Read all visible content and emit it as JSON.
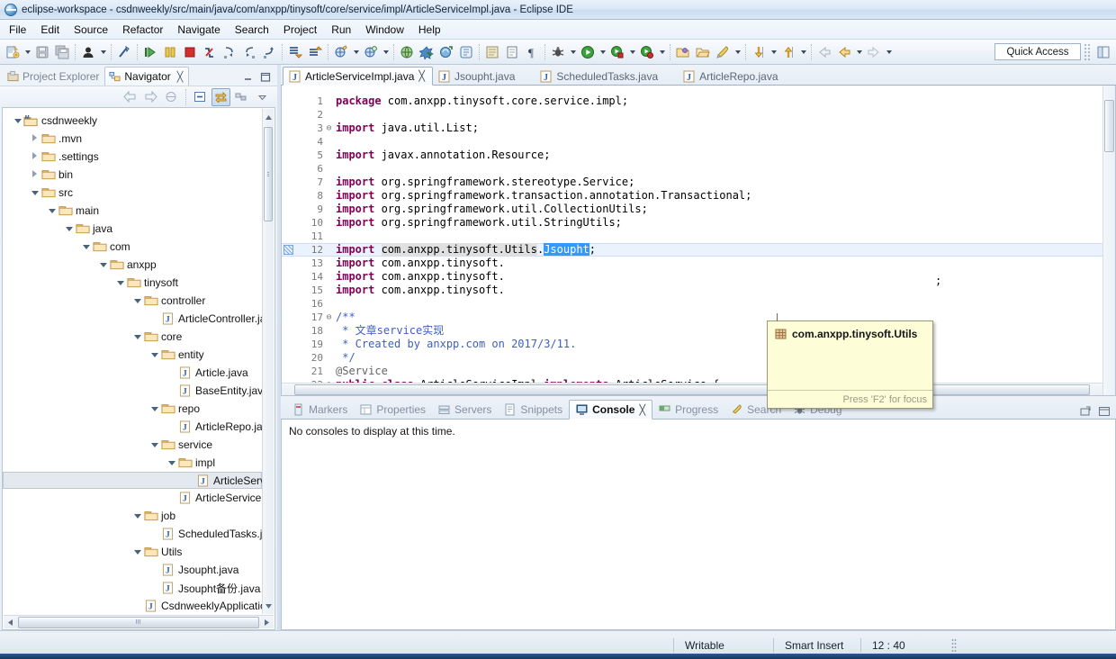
{
  "window": {
    "title": "eclipse-workspace - csdnweekly/src/main/java/com/anxpp/tinysoft/core/service/impl/ArticleServiceImpl.java - Eclipse IDE"
  },
  "menubar": {
    "items": [
      "File",
      "Edit",
      "Source",
      "Refactor",
      "Navigate",
      "Search",
      "Project",
      "Run",
      "Window",
      "Help"
    ]
  },
  "toolbar": {
    "quick_access": "Quick Access",
    "icons": [
      "new-wizard-icon",
      "new-dropdown-icon",
      "save-icon",
      "save-all-icon",
      "person-icon",
      "person-dropdown-icon",
      "toggle-breakpoint-icon",
      "resume-icon",
      "suspend-icon",
      "terminate-icon",
      "disconnect-icon",
      "step-into-icon",
      "step-over-icon",
      "step-return-icon",
      "next-annotation-icon",
      "previous-annotation-icon",
      "open-type-icon",
      "open-type-dropdown-icon",
      "search-icon",
      "search-dropdown-icon",
      "web-browser-icon",
      "debug-perspective-icon",
      "new-java-project-icon",
      "java-editor-icon",
      "new-class-icon",
      "new-package-icon",
      "toggle-mark-occurrences-icon",
      "show-whitespace-icon",
      "pilcrow-icon",
      "debug-launch-icon",
      "debug-dropdown-icon",
      "run-launch-icon",
      "run-dropdown-icon",
      "run-coverage-icon",
      "coverage-dropdown-icon",
      "external-tools-icon",
      "external-tools-dropdown-icon",
      "open-folder-icon",
      "open-file-icon",
      "run-ant-icon",
      "run-ant-dropdown-icon",
      "previous-edit-icon",
      "previous-dropdown-icon",
      "next-edit-icon",
      "next-dropdown-icon",
      "back-icon",
      "forward-icon",
      "forward-dropdown-icon",
      "next-page-icon",
      "next-page-dropdown-icon"
    ]
  },
  "left_view": {
    "tabs": [
      {
        "label": "Project Explorer",
        "active": false,
        "icon": "project-explorer-icon"
      },
      {
        "label": "Navigator",
        "active": true,
        "icon": "navigator-icon",
        "close": "╳"
      }
    ],
    "controls": [
      "minimize-icon",
      "maximize-icon"
    ],
    "view_toolbar": [
      "back-icon",
      "forward-icon",
      "home-icon",
      "collapse-all-icon",
      "link-with-editor-icon",
      "view-menu-icon",
      "view-dropdown-icon"
    ],
    "tree": [
      {
        "label": "csdnweekly",
        "depth": 0,
        "state": "expanded",
        "icon": "project-icon"
      },
      {
        "label": ".mvn",
        "depth": 1,
        "state": "collapsed",
        "icon": "folder-icon"
      },
      {
        "label": ".settings",
        "depth": 1,
        "state": "collapsed",
        "icon": "folder-icon"
      },
      {
        "label": "bin",
        "depth": 1,
        "state": "collapsed",
        "icon": "folder-icon"
      },
      {
        "label": "src",
        "depth": 1,
        "state": "expanded",
        "icon": "folder-icon"
      },
      {
        "label": "main",
        "depth": 2,
        "state": "expanded",
        "icon": "folder-icon"
      },
      {
        "label": "java",
        "depth": 3,
        "state": "expanded",
        "icon": "folder-icon"
      },
      {
        "label": "com",
        "depth": 4,
        "state": "expanded",
        "icon": "folder-icon"
      },
      {
        "label": "anxpp",
        "depth": 5,
        "state": "expanded",
        "icon": "folder-icon"
      },
      {
        "label": "tinysoft",
        "depth": 6,
        "state": "expanded",
        "icon": "folder-icon"
      },
      {
        "label": "controller",
        "depth": 7,
        "state": "expanded",
        "icon": "folder-icon"
      },
      {
        "label": "ArticleController.java",
        "depth": 8,
        "state": "leaf",
        "icon": "java-file-icon"
      },
      {
        "label": "core",
        "depth": 7,
        "state": "expanded",
        "icon": "folder-icon"
      },
      {
        "label": "entity",
        "depth": 8,
        "state": "expanded",
        "icon": "folder-icon"
      },
      {
        "label": "Article.java",
        "depth": 9,
        "state": "leaf",
        "icon": "java-file-icon"
      },
      {
        "label": "BaseEntity.java",
        "depth": 9,
        "state": "leaf",
        "icon": "java-file-icon"
      },
      {
        "label": "repo",
        "depth": 8,
        "state": "expanded",
        "icon": "folder-icon"
      },
      {
        "label": "ArticleRepo.java",
        "depth": 9,
        "state": "leaf",
        "icon": "java-file-icon"
      },
      {
        "label": "service",
        "depth": 8,
        "state": "expanded",
        "icon": "folder-icon"
      },
      {
        "label": "impl",
        "depth": 9,
        "state": "expanded",
        "icon": "folder-icon"
      },
      {
        "label": "ArticleServiceImpl.java",
        "depth": 10,
        "state": "leaf",
        "icon": "java-file-icon",
        "selected": true
      },
      {
        "label": "ArticleService.java",
        "depth": 9,
        "state": "leaf",
        "icon": "java-file-icon"
      },
      {
        "label": "job",
        "depth": 7,
        "state": "expanded",
        "icon": "folder-icon"
      },
      {
        "label": "ScheduledTasks.java",
        "depth": 8,
        "state": "leaf",
        "icon": "java-file-icon"
      },
      {
        "label": "Utils",
        "depth": 7,
        "state": "expanded",
        "icon": "folder-icon"
      },
      {
        "label": "Jsoupht.java",
        "depth": 8,
        "state": "leaf",
        "icon": "java-file-icon"
      },
      {
        "label": "Jsoupht备份.java",
        "depth": 8,
        "state": "leaf",
        "icon": "java-file-icon"
      },
      {
        "label": "CsdnweeklyApplication.ja",
        "depth": 7,
        "state": "leaf",
        "icon": "java-file-icon"
      }
    ]
  },
  "editor": {
    "tabs": [
      {
        "label": "ArticleServiceImpl.java",
        "active": true,
        "close": "╳"
      },
      {
        "label": "Jsoupht.java",
        "active": false
      },
      {
        "label": "ScheduledTasks.java",
        "active": false
      },
      {
        "label": "ArticleRepo.java",
        "active": false
      }
    ],
    "lines": [
      {
        "n": "1",
        "fold": "",
        "segments": [
          {
            "t": "package ",
            "c": "kw"
          },
          {
            "t": "com.anxpp.tinysoft.core.service.impl;",
            "c": ""
          }
        ]
      },
      {
        "n": "2",
        "fold": "",
        "segments": []
      },
      {
        "n": "3",
        "fold": "⊖",
        "segments": [
          {
            "t": "import ",
            "c": "kw"
          },
          {
            "t": "java.util.List;",
            "c": ""
          }
        ]
      },
      {
        "n": "4",
        "fold": "",
        "segments": []
      },
      {
        "n": "5",
        "fold": "",
        "segments": [
          {
            "t": "import ",
            "c": "kw"
          },
          {
            "t": "javax.annotation.Resource;",
            "c": ""
          }
        ]
      },
      {
        "n": "6",
        "fold": "",
        "segments": []
      },
      {
        "n": "7",
        "fold": "",
        "segments": [
          {
            "t": "import ",
            "c": "kw"
          },
          {
            "t": "org.springframework.stereotype.Service;",
            "c": ""
          }
        ]
      },
      {
        "n": "8",
        "fold": "",
        "segments": [
          {
            "t": "import ",
            "c": "kw"
          },
          {
            "t": "org.springframework.transaction.annotation.Transactional;",
            "c": ""
          }
        ]
      },
      {
        "n": "9",
        "fold": "",
        "segments": [
          {
            "t": "import ",
            "c": "kw"
          },
          {
            "t": "org.springframework.util.CollectionUtils;",
            "c": ""
          }
        ]
      },
      {
        "n": "10",
        "fold": "",
        "segments": [
          {
            "t": "import ",
            "c": "kw"
          },
          {
            "t": "org.springframework.util.StringUtils;",
            "c": ""
          }
        ]
      },
      {
        "n": "11",
        "fold": "",
        "segments": []
      },
      {
        "n": "12",
        "fold": "",
        "highlight": true,
        "mark": true,
        "segments": [
          {
            "t": "import ",
            "c": "kw"
          },
          {
            "t": "com.anxpp.tinysoft.Utils",
            "c": "occ"
          },
          {
            "t": ".",
            "c": ""
          },
          {
            "t": "Jsoupht",
            "c": "selhl"
          },
          {
            "t": ";",
            "c": ""
          }
        ]
      },
      {
        "n": "13",
        "fold": "",
        "segments": [
          {
            "t": "import ",
            "c": "kw"
          },
          {
            "t": "com.anxpp.tinysoft.",
            "c": ""
          }
        ]
      },
      {
        "n": "14",
        "fold": "",
        "segments": [
          {
            "t": "import ",
            "c": "kw"
          },
          {
            "t": "com.anxpp.tinysoft.",
            "c": ""
          }
        ]
      },
      {
        "n": "15",
        "fold": "",
        "segments": [
          {
            "t": "import ",
            "c": "kw"
          },
          {
            "t": "com.anxpp.tinysoft.",
            "c": ""
          }
        ]
      },
      {
        "n": "16",
        "fold": "",
        "segments": []
      },
      {
        "n": "17",
        "fold": "⊖",
        "segments": [
          {
            "t": "/**",
            "c": "cm"
          }
        ]
      },
      {
        "n": "18",
        "fold": "",
        "segments": [
          {
            "t": " * 文章service实现",
            "c": "cm"
          }
        ]
      },
      {
        "n": "19",
        "fold": "",
        "segments": [
          {
            "t": " * Created by anxpp.com on 2017/3/11.",
            "c": "cm"
          }
        ]
      },
      {
        "n": "20",
        "fold": "",
        "segments": [
          {
            "t": " */",
            "c": "cm"
          }
        ]
      },
      {
        "n": "21",
        "fold": "",
        "segments": [
          {
            "t": "@Service",
            "c": "an"
          }
        ]
      },
      {
        "n": "22",
        "fold": "⊖",
        "segments": [
          {
            "t": "public class ",
            "c": "kw"
          },
          {
            "t": "ArticleServiceImpl ",
            "c": ""
          },
          {
            "t": "implements ",
            "c": "kw"
          },
          {
            "t": "ArticleService {",
            "c": ""
          }
        ]
      }
    ],
    "line15_tail": ";",
    "tooltip": {
      "title": "com.anxpp.tinysoft.Utils",
      "footer": "Press 'F2' for focus",
      "icon": "package-icon"
    }
  },
  "bottom_view": {
    "tabs": [
      {
        "label": "Markers",
        "active": false,
        "icon": "markers-icon"
      },
      {
        "label": "Properties",
        "active": false,
        "icon": "properties-icon"
      },
      {
        "label": "Servers",
        "active": false,
        "icon": "servers-icon"
      },
      {
        "label": "Snippets",
        "active": false,
        "icon": "snippets-icon"
      },
      {
        "label": "Console",
        "active": true,
        "icon": "console-icon",
        "close": "╳"
      },
      {
        "label": "Progress",
        "active": false,
        "icon": "progress-icon"
      },
      {
        "label": "Search",
        "active": false,
        "icon": "search-icon"
      },
      {
        "label": "Debug",
        "active": false,
        "icon": "debug-icon"
      }
    ],
    "controls": [
      "minimize-icon",
      "maximize-icon"
    ],
    "message": "No consoles to display at this time."
  },
  "statusbar": {
    "writable": "Writable",
    "insert_mode": "Smart Insert",
    "cursor_position": "12 : 40"
  },
  "colors": {
    "keyword": "#7f0055",
    "comment": "#3f5fbf",
    "selection": "#3399ff",
    "tooltip_bg": "#fdfdd8",
    "line_highlight": "#eaf2fd"
  }
}
